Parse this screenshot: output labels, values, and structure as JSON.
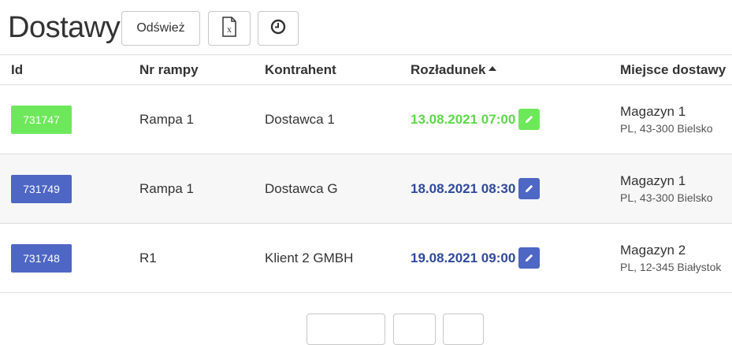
{
  "page": {
    "title": "Dostawy"
  },
  "toolbar": {
    "refresh_label": "Odśwież",
    "excel_icon": "excel-file-icon",
    "history_icon": "clock-icon"
  },
  "table": {
    "headers": {
      "id": "Id",
      "ramp": "Nr rampy",
      "contractor": "Kontrahent",
      "unloading": "Rozładunek",
      "destination": "Miejsce dostawy"
    },
    "sort": {
      "column": "unloading",
      "direction": "ascending"
    },
    "rows": [
      {
        "id": "731747",
        "ramp": "Rampa 1",
        "contractor": "Dostawca 1",
        "unloading": "13.08.2021 07:00",
        "dest_name": "Magazyn 1",
        "dest_addr": "PL, 43-300 Bielsko",
        "color": "#6ee85b"
      },
      {
        "id": "731749",
        "ramp": "Rampa 1",
        "contractor": "Dostawca G",
        "unloading": "18.08.2021 08:30",
        "dest_name": "Magazyn 1",
        "dest_addr": "PL, 43-300 Bielsko",
        "color": "#4e66c4"
      },
      {
        "id": "731748",
        "ramp": "R1",
        "contractor": "Klient 2 GMBH",
        "unloading": "19.08.2021 09:00",
        "dest_name": "Magazyn 2",
        "dest_addr": "PL, 12-345 Białystok",
        "color": "#4e66c4"
      }
    ]
  },
  "colors": {
    "green": "#6ee85b",
    "blue": "#4e66c4",
    "green_text": "#5ed84a",
    "blue_text": "#2f4a9c"
  }
}
